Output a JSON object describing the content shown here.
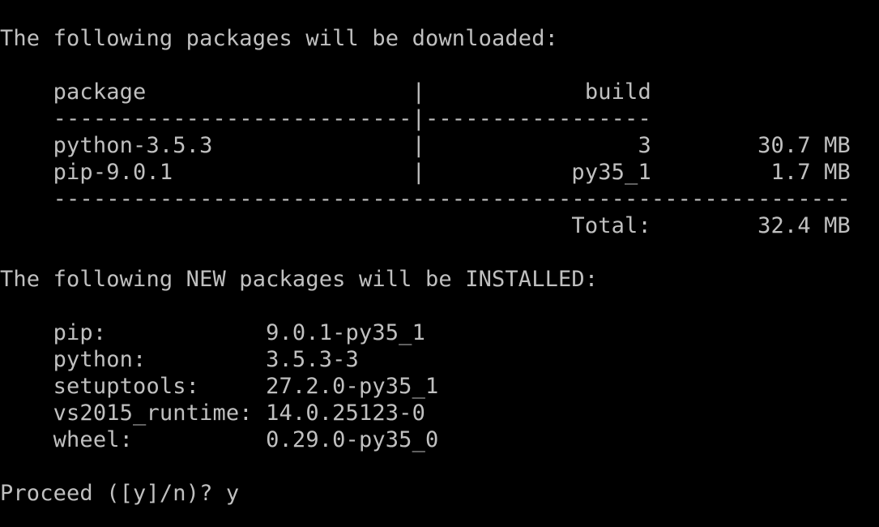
{
  "terminal": {
    "colors": {
      "background": "#000000",
      "foreground": "#c0c0c0"
    },
    "download_heading": "The following packages will be downloaded:",
    "download_table": {
      "header": "    package                    |            build",
      "header_rule": "    ---------------------------|-----------------",
      "rows": [
        "    python-3.5.3               |                3        30.7 MB",
        "    pip-9.0.1                  |           py35_1         1.7 MB"
      ],
      "footer_rule": "    ------------------------------------------------------------",
      "total": "                                           Total:        32.4 MB"
    },
    "install_heading": "The following NEW packages will be INSTALLED:",
    "install_list": [
      "    pip:            9.0.1-py35_1",
      "    python:         3.5.3-3",
      "    setuptools:     27.2.0-py35_1",
      "    vs2015_runtime: 14.0.25123-0",
      "    wheel:          0.29.0-py35_0"
    ],
    "prompt": "Proceed ([y]/n)? y"
  }
}
